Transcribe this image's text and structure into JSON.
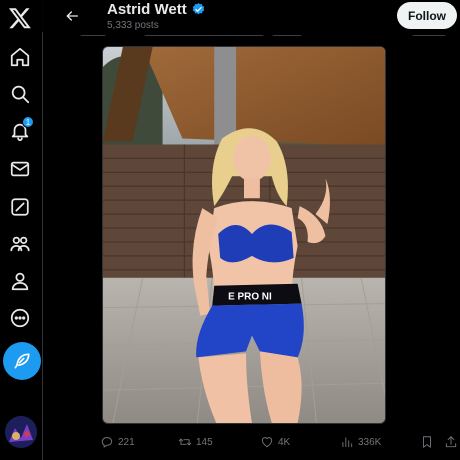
{
  "header": {
    "display_name": "Astrid Wett",
    "post_count": "5,333 posts",
    "follow_label": "Follow"
  },
  "sidebar": {
    "notifications_badge": "1",
    "items": [
      "x-logo-icon",
      "home-icon",
      "search-icon",
      "notifications-icon",
      "messages-icon",
      "grok-icon",
      "communities-icon",
      "profile-icon",
      "more-icon"
    ]
  },
  "post": {
    "replies": "221",
    "reposts": "145",
    "likes": "4K",
    "views": "336K"
  },
  "colors": {
    "accent": "#1d9bf0",
    "background": "#000000",
    "text": "#e7e9ea",
    "muted": "#71767b"
  }
}
